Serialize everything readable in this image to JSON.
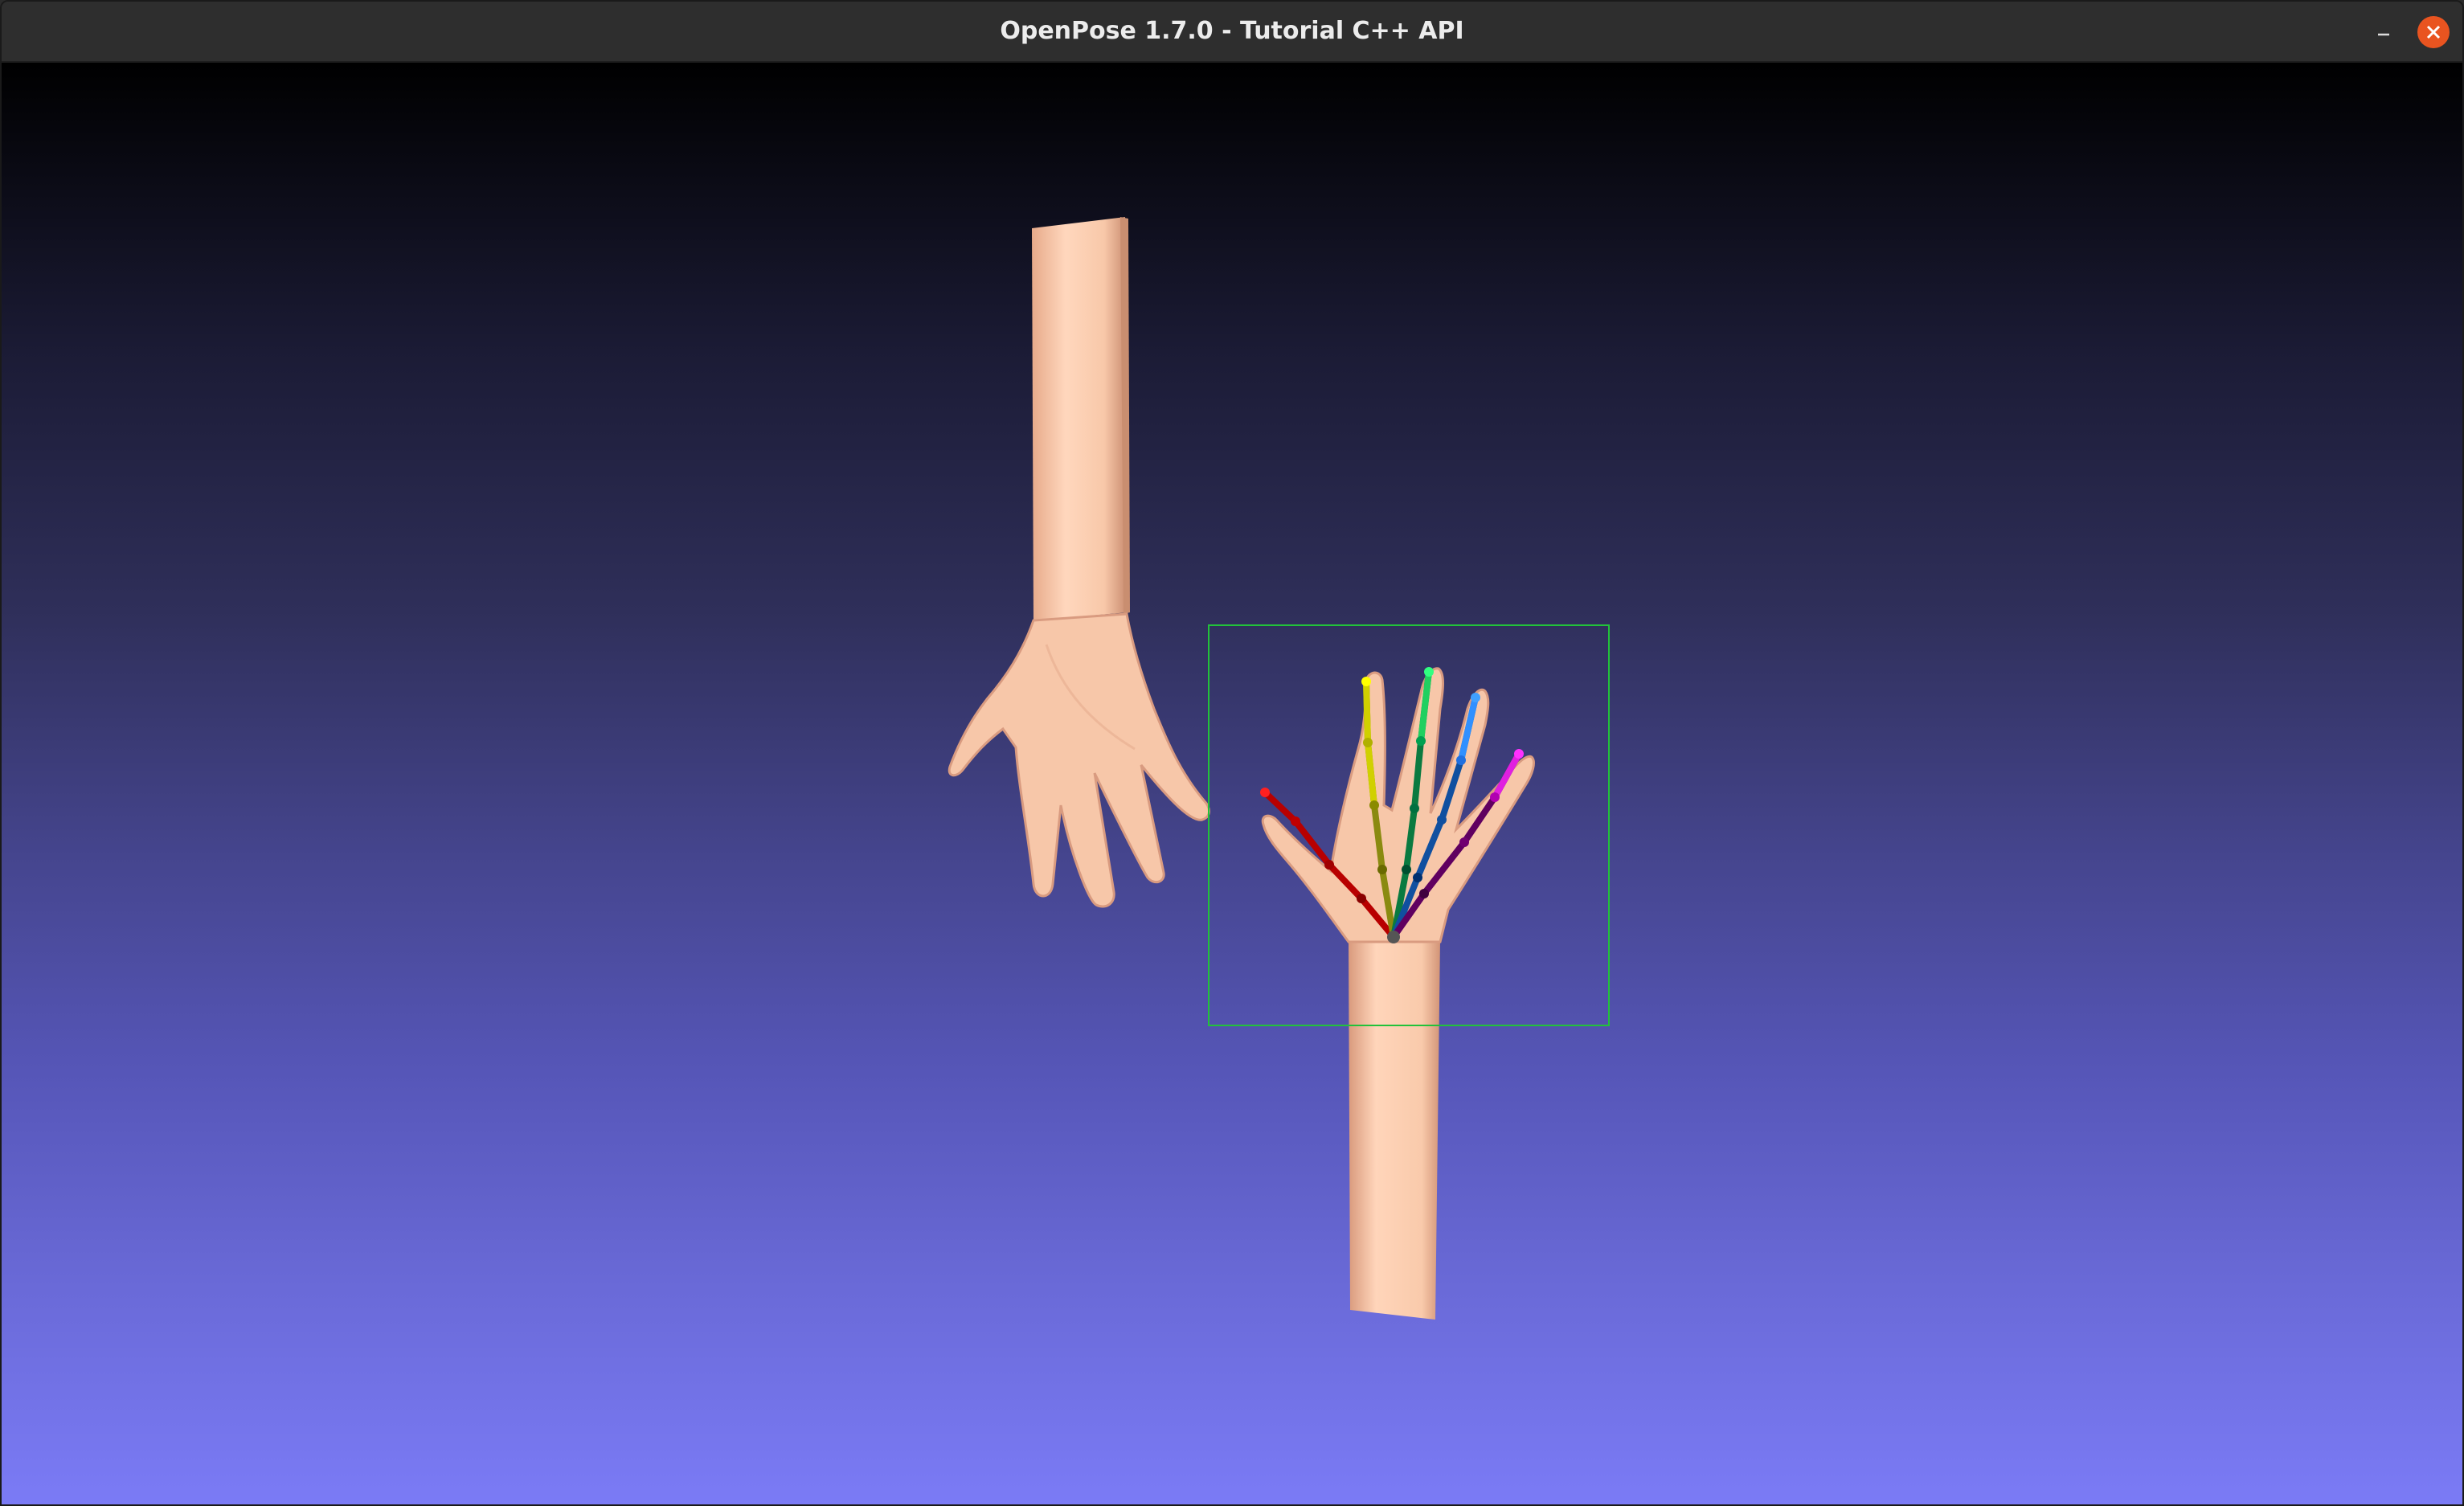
{
  "window": {
    "title": "OpenPose 1.7.0 - Tutorial C++ API",
    "minimize_icon": "minimize-icon",
    "close_icon": "close-icon",
    "close_color": "#e95420"
  },
  "viewport": {
    "background_top": "#000000",
    "background_bottom": "#7b7bf6",
    "bounding_box_color": "#22c23a",
    "skin_color": "#f7c9ab"
  },
  "keypoints": {
    "finger_colors": {
      "thumb": "#d00000",
      "index": "#c8c800",
      "middle": "#00c060",
      "ring": "#2070ff",
      "pinky": "#e000e0"
    }
  }
}
